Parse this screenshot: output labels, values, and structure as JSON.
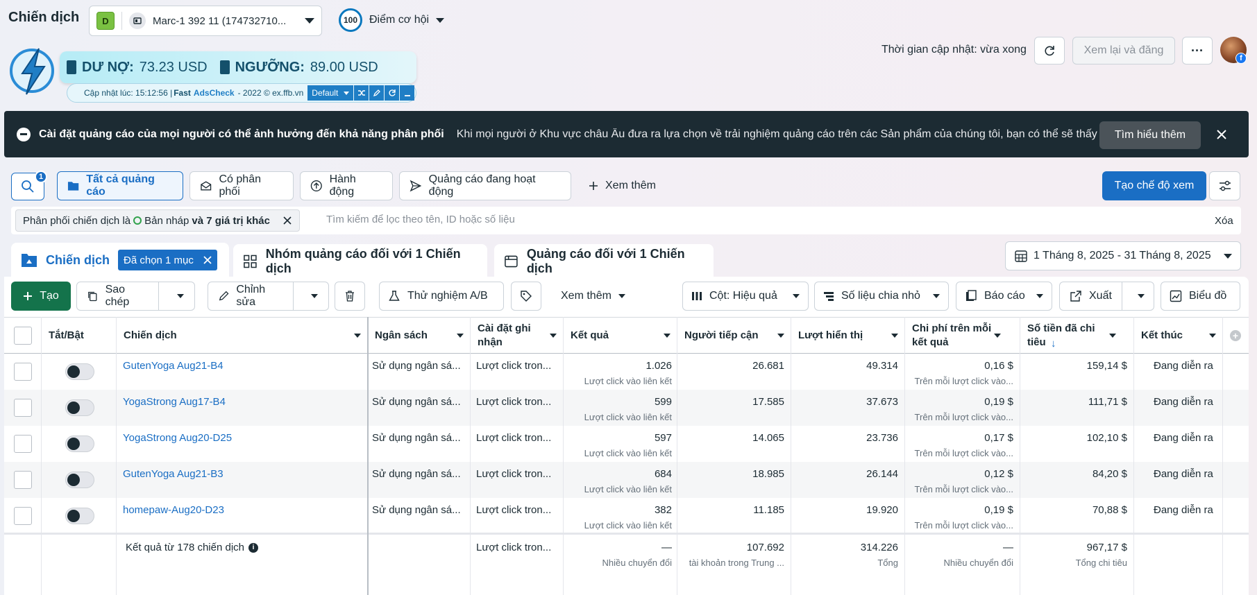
{
  "header": {
    "title": "Chiến dịch",
    "account_initial": "D",
    "account_name": "Marc-1 392 11 (174732710...",
    "score": "100",
    "score_label": "Điểm cơ hội",
    "update_time": "Thời gian cập nhật: vừa xong",
    "review_publish": "Xem lại và đăng",
    "more": "···",
    "fb_badge": "f"
  },
  "widget": {
    "debt_label": "DƯ NỢ:",
    "debt_value": "73.23 USD",
    "threshold_label": "NGƯỠNG:",
    "threshold_value": "89.00 USD",
    "updated_prefix": "Cập nhật lúc: 15:12:56 |",
    "brand_fast": "Fast",
    "brand_ads": "AdsCheck",
    "brand_suffix": "- 2022 © ex.ffb.vn",
    "mode": "Default"
  },
  "banner": {
    "title": "Cài đặt quảng cáo của mọi người có thể ảnh hưởng đến khả năng phân phối",
    "text": "Khi mọi người ở Khu vực châu Âu đưa ra lựa chọn về trải nghiệm quảng cáo trên các Sản phẩm của chúng tôi, bạn có thể sẽ thấy tác...",
    "learn_more": "Tìm hiểu thêm"
  },
  "filter_tabs": {
    "search_badge": "1",
    "all_ads": "Tất cả quảng cáo",
    "delivering": "Có phân phối",
    "actions": "Hành động",
    "active_ads": "Quảng cáo đang hoạt động",
    "see_more": "Xem thêm",
    "create_view": "Tạo chế độ xem"
  },
  "filter_bar": {
    "chip_prefix": "Phân phối chiến dịch là",
    "chip_value": "Bản nháp",
    "chip_suffix": "và 7 giá trị khác",
    "placeholder": "Tìm kiếm để lọc theo tên, ID hoặc số liệu",
    "clear": "Xóa"
  },
  "level_tabs": {
    "campaigns": "Chiến dịch",
    "selected": "Đã chọn 1 mục",
    "adsets": "Nhóm quảng cáo đối với 1 Chiến dịch",
    "ads": "Quảng cáo đối với 1 Chiến dịch",
    "date_range": "1 Tháng 8, 2025 - 31 Tháng 8, 2025"
  },
  "toolbar": {
    "create": "Tạo",
    "duplicate": "Sao chép",
    "edit": "Chỉnh sửa",
    "ab_test": "Thử nghiệm A/B",
    "more": "Xem thêm",
    "columns": "Cột: Hiệu quả",
    "breakdown": "Số liệu chia nhỏ",
    "reports": "Báo cáo",
    "export": "Xuất",
    "charts": "Biểu đồ"
  },
  "table": {
    "headers": {
      "toggle": "Tắt/Bật",
      "campaign": "Chiến dịch",
      "budget": "Ngân sách",
      "attribution": "Cài đặt ghi nhận",
      "results": "Kết quả",
      "reach": "Người tiếp cận",
      "impressions": "Lượt hiển thị",
      "cpr": "Chi phí trên mỗi kết quả",
      "spent": "Số tiền đã chi tiêu",
      "spent_arrow": "↓",
      "ends": "Kết thúc"
    },
    "rows": [
      {
        "name": "GutenYoga Aug21-B4",
        "budget": "Sử dụng ngân sá...",
        "attribution": "Lượt click tron...",
        "results": "1.026",
        "results_sub": "Lượt click vào liên kết",
        "reach": "26.681",
        "impressions": "49.314",
        "cpr": "0,16 $",
        "cpr_sub": "Trên mỗi lượt click vào...",
        "spent": "159,14 $",
        "ends": "Đang diễn ra"
      },
      {
        "name": "YogaStrong Aug17-B4",
        "budget": "Sử dụng ngân sá...",
        "attribution": "Lượt click tron...",
        "results": "599",
        "results_sub": "Lượt click vào liên kết",
        "reach": "17.585",
        "impressions": "37.673",
        "cpr": "0,19 $",
        "cpr_sub": "Trên mỗi lượt click vào...",
        "spent": "111,71 $",
        "ends": "Đang diễn ra"
      },
      {
        "name": "YogaStrong Aug20-D25",
        "budget": "Sử dụng ngân sá...",
        "attribution": "Lượt click tron...",
        "results": "597",
        "results_sub": "Lượt click vào liên kết",
        "reach": "14.065",
        "impressions": "23.736",
        "cpr": "0,17 $",
        "cpr_sub": "Trên mỗi lượt click vào...",
        "spent": "102,10 $",
        "ends": "Đang diễn ra"
      },
      {
        "name": "GutenYoga Aug21-B3",
        "budget": "Sử dụng ngân sá...",
        "attribution": "Lượt click tron...",
        "results": "684",
        "results_sub": "Lượt click vào liên kết",
        "reach": "18.985",
        "impressions": "26.144",
        "cpr": "0,12 $",
        "cpr_sub": "Trên mỗi lượt click vào...",
        "spent": "84,20 $",
        "ends": "Đang diễn ra"
      },
      {
        "name": "homepaw-Aug20-D23",
        "budget": "Sử dụng ngân sá...",
        "attribution": "Lượt click tron...",
        "results": "382",
        "results_sub": "Lượt click vào liên kết",
        "reach": "11.185",
        "impressions": "19.920",
        "cpr": "0,19 $",
        "cpr_sub": "Trên mỗi lượt click vào...",
        "spent": "70,88 $",
        "ends": "Đang diễn ra"
      }
    ],
    "summary": {
      "label": "Kết quả từ 178 chiến dịch",
      "attribution": "Lượt click tron...",
      "results": "—",
      "results_sub": "Nhiều chuyển đổi",
      "reach": "107.692",
      "reach_sub": "tài khoản trong Trung ...",
      "impressions": "314.226",
      "impressions_sub": "Tổng",
      "cpr": "—",
      "cpr_sub": "Nhiều chuyển đổi",
      "spent": "967,17 $",
      "spent_sub": "Tổng chi tiêu"
    }
  },
  "colors": {
    "primary": "#1a6ec4",
    "create_green": "#14734b",
    "banner_dark": "#1c2b33"
  }
}
